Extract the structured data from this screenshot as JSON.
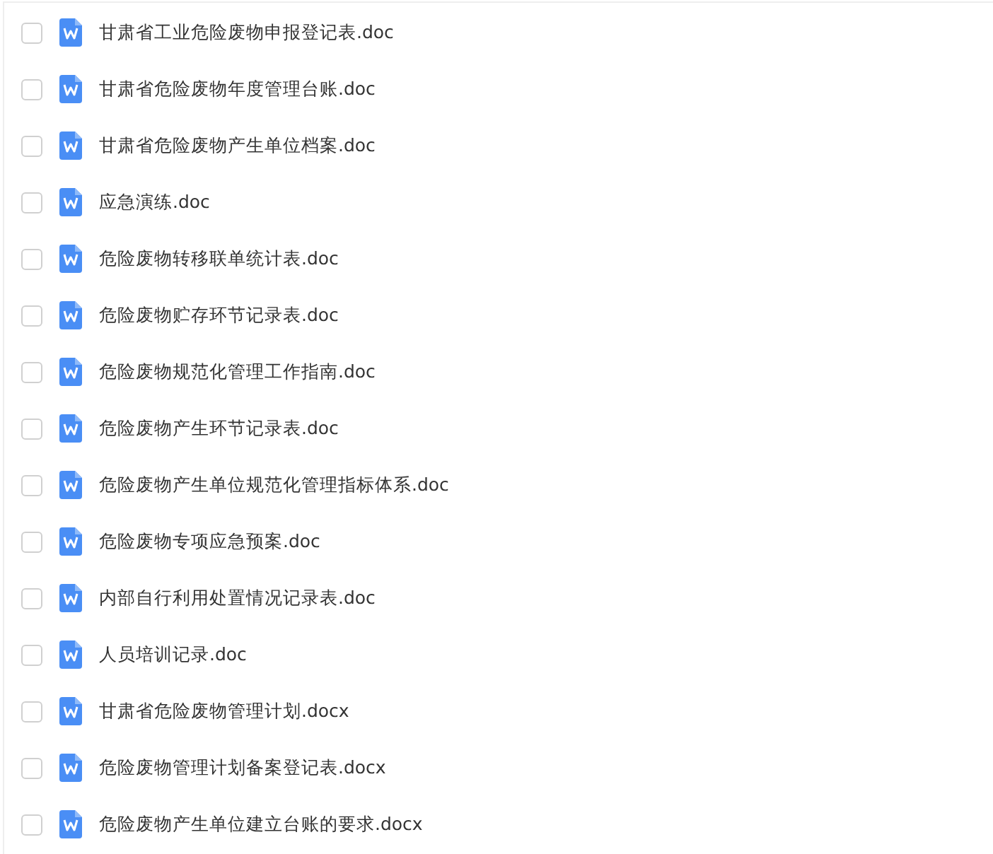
{
  "files": [
    {
      "name": "甘肃省工业危险废物申报登记表.doc",
      "checked": false
    },
    {
      "name": "甘肃省危险废物年度管理台账.doc",
      "checked": false
    },
    {
      "name": "甘肃省危险废物产生单位档案.doc",
      "checked": false
    },
    {
      "name": "应急演练.doc",
      "checked": false
    },
    {
      "name": "危险废物转移联单统计表.doc",
      "checked": false
    },
    {
      "name": "危险废物贮存环节记录表.doc",
      "checked": false
    },
    {
      "name": "危险废物规范化管理工作指南.doc",
      "checked": false
    },
    {
      "name": "危险废物产生环节记录表.doc",
      "checked": false
    },
    {
      "name": "危险废物产生单位规范化管理指标体系.doc",
      "checked": false
    },
    {
      "name": "危险废物专项应急预案.doc",
      "checked": false
    },
    {
      "name": "内部自行利用处置情况记录表.doc",
      "checked": false
    },
    {
      "name": "人员培训记录.doc",
      "checked": false
    },
    {
      "name": "甘肃省危险废物管理计划.docx",
      "checked": false
    },
    {
      "name": "危险废物管理计划备案登记表.docx",
      "checked": false
    },
    {
      "name": "危险废物产生单位建立台账的要求.docx",
      "checked": false
    }
  ]
}
